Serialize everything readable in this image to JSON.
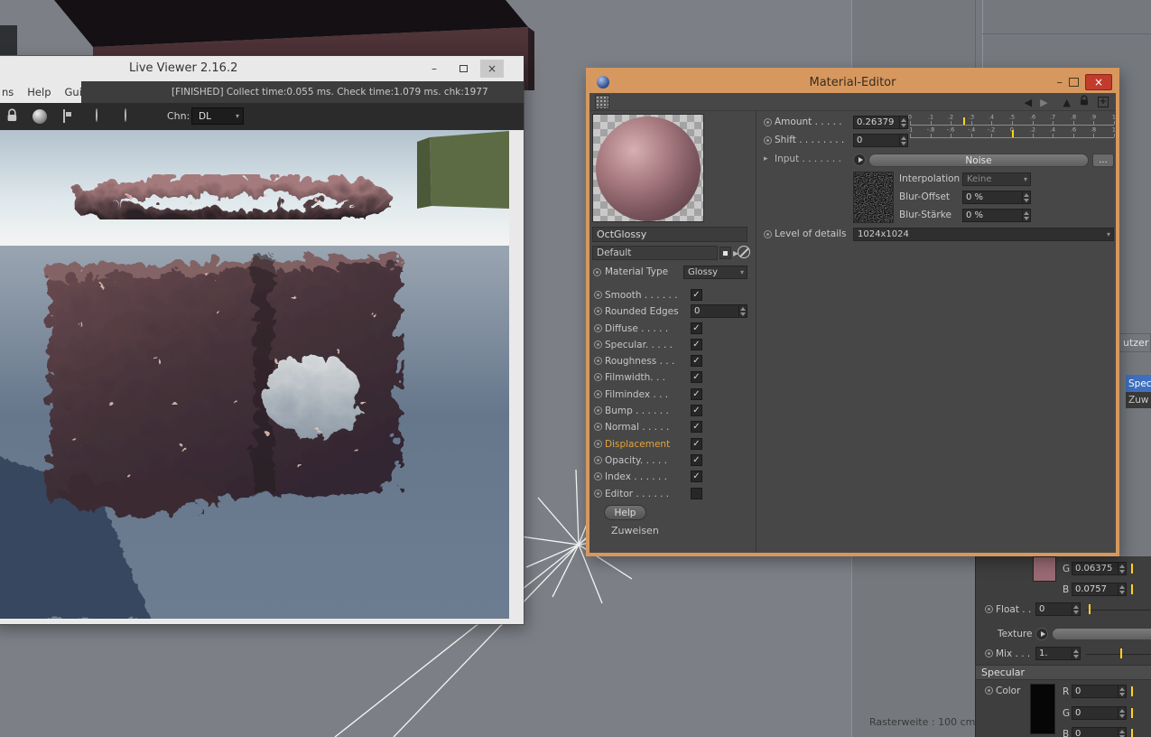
{
  "background": {
    "rasterweite": "Rasterweite : 100 cm"
  },
  "live_viewer": {
    "title": "Live Viewer 2.16.2",
    "controls": {
      "minimize": "–",
      "close": "×"
    },
    "menu": [
      "ns",
      "Help",
      "Gui"
    ],
    "status": "[FINISHED] Collect time:0.055 ms.  Check time:1.079 ms.  chk:1977",
    "toolbar": {
      "chn_label": "Chn:",
      "channel": "DL",
      "caret": "▾"
    }
  },
  "material_editor": {
    "title": "Material-Editor",
    "controls": {
      "minimize": "–",
      "close": "×"
    },
    "left": {
      "name": "OctGlossy",
      "preset": "Default",
      "preset_arrow": "▶",
      "type_label": "Material Type",
      "type_value": "Glossy",
      "channels": [
        {
          "key": "smooth",
          "label": "Smooth . . . . . .",
          "control": "check",
          "checked": true
        },
        {
          "key": "rounded-edges",
          "label": "Rounded Edges",
          "control": "spin",
          "value": "0"
        },
        {
          "key": "diffuse",
          "label": "Diffuse . . . . .",
          "control": "check",
          "checked": true
        },
        {
          "key": "specular",
          "label": "Specular. . . . .",
          "control": "check",
          "checked": true
        },
        {
          "key": "roughness",
          "label": "Roughness . . .",
          "control": "check",
          "checked": true
        },
        {
          "key": "filmwidth",
          "label": "Filmwidth. . .",
          "control": "check",
          "checked": true
        },
        {
          "key": "filmindex",
          "label": "Filmindex . . .",
          "control": "check",
          "checked": true
        },
        {
          "key": "bump",
          "label": "Bump . . . . . .",
          "control": "check",
          "checked": true
        },
        {
          "key": "normal",
          "label": "Normal . . . . .",
          "control": "check",
          "checked": true
        },
        {
          "key": "displacement",
          "label": "Displacement",
          "control": "check",
          "checked": true,
          "active": true
        },
        {
          "key": "opacity",
          "label": "Opacity. . . . .",
          "control": "check",
          "checked": true
        },
        {
          "key": "index",
          "label": "Index . . . . . .",
          "control": "check",
          "checked": true
        },
        {
          "key": "editor",
          "label": "Editor . . . . . .",
          "control": "check",
          "checked": false
        }
      ],
      "help": "Help",
      "zuweisen": "Zuweisen"
    },
    "right": {
      "amount_label": "Amount . . . . .",
      "amount_value": "0.26379",
      "shift_label": "Shift . . . . . . . .",
      "shift_value": "0",
      "input_label": "Input . . . . . . .",
      "input_expander": "▸",
      "input_button": "Noise",
      "more_button": "...",
      "interpolation_label": "Interpolation",
      "interpolation_value": "Keine",
      "blur_offset_label": "Blur-Offset",
      "blur_offset_value": "0 %",
      "blur_strength_label": "Blur-Stärke",
      "blur_strength_value": "0 %",
      "lod_label": "Level of details",
      "lod_value": "1024x1024",
      "amount_scale": [
        "0",
        ".1",
        ".2",
        ".3",
        ".4",
        ".5",
        ".6",
        ".7",
        ".8",
        ".9",
        "1"
      ],
      "amount_marker_pct": 26,
      "shift_scale": [
        "-1",
        "-.8",
        "-.6",
        "-.4",
        "-.2",
        "0",
        ".2",
        ".4",
        ".6",
        ".8",
        "1"
      ],
      "shift_marker_pct": 50
    }
  },
  "side_fragments": {
    "tab_cut": "utzer",
    "spec": "Spec",
    "zuw": "Zuw"
  },
  "bottom_panel": {
    "rows_top": [
      {
        "label": "G",
        "value": "0.06375"
      },
      {
        "label": "B",
        "value": "0.0757"
      }
    ],
    "float_label": "Float . .",
    "float_value": "0",
    "texture_label": "Texture",
    "mix_label": "Mix . . .",
    "mix_value": "1.",
    "specular_header": "Specular",
    "color_label": "Color",
    "rgb_rows": [
      {
        "label": "R",
        "value": "0"
      },
      {
        "label": "G",
        "value": "0"
      },
      {
        "label": "B",
        "value": "0"
      }
    ]
  },
  "icons": {
    "lv_lock": "padlock",
    "lv_render": "sphere",
    "lv_region": "frame",
    "lv_pick_p": "circle-dot",
    "lv_pick_r": "circle-dot",
    "me_grid": "dot-grid",
    "nav_back": "◀",
    "nav_forward": "▶",
    "nav_up": "▲",
    "me_lock": "padlock",
    "add_box": "+",
    "slash_preview": "circle-slash",
    "caret_down": "▾"
  },
  "colors": {
    "frame_orange": "#d6985f",
    "active_channel_orange": "#e4a33a",
    "selection_blue": "#3f6fbe",
    "marker_yellow": "#ffd21e",
    "mauve_swatch": "#9a6a74",
    "black_swatch": "#060606",
    "close_red": "#c23b2d"
  }
}
